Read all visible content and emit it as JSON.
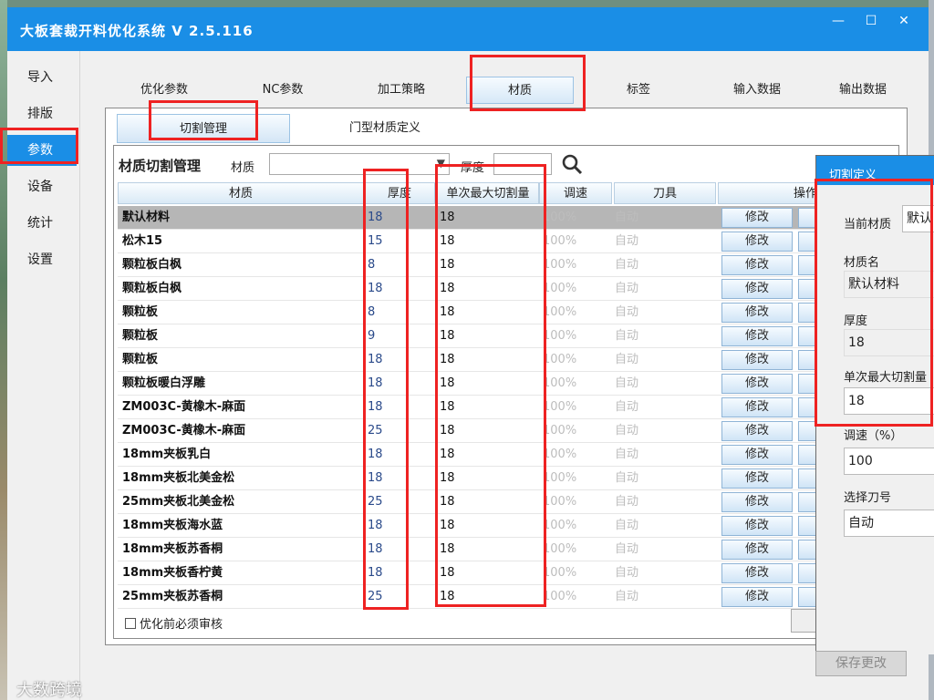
{
  "window": {
    "title": "大板套裁开料优化系统  V 2.5.116",
    "controls": {
      "minimize": "—",
      "maximize": "☐",
      "close": "✕"
    }
  },
  "leftnav": [
    "导入",
    "排版",
    "参数",
    "设备",
    "统计",
    "设置"
  ],
  "toptabs": [
    "优化参数",
    "NC参数",
    "加工策略",
    "材质",
    "标签",
    "输入数据",
    "输出数据"
  ],
  "subtabs": [
    "切割管理",
    "门型材质定义"
  ],
  "toolbar": {
    "title": "材质切割管理",
    "material_label": "材质",
    "material_value": "",
    "thickness_label": "厚度",
    "thickness_value": ""
  },
  "table": {
    "headers": [
      "材质",
      "厚度",
      "单次最大切割量",
      "调速",
      "刀具",
      "操作"
    ],
    "rows": [
      {
        "name": "默认材料",
        "thick": "18",
        "max": "18",
        "speed": "100%",
        "tool": "自动"
      },
      {
        "name": "松木15",
        "thick": "15",
        "max": "18",
        "speed": "100%",
        "tool": "自动"
      },
      {
        "name": "颗粒板白枫",
        "thick": "8",
        "max": "18",
        "speed": "100%",
        "tool": "自动"
      },
      {
        "name": "颗粒板白枫",
        "thick": "18",
        "max": "18",
        "speed": "100%",
        "tool": "自动"
      },
      {
        "name": "颗粒板",
        "thick": "8",
        "max": "18",
        "speed": "100%",
        "tool": "自动"
      },
      {
        "name": "颗粒板",
        "thick": "9",
        "max": "18",
        "speed": "100%",
        "tool": "自动"
      },
      {
        "name": "颗粒板",
        "thick": "18",
        "max": "18",
        "speed": "100%",
        "tool": "自动"
      },
      {
        "name": "颗粒板暖白浮雕",
        "thick": "18",
        "max": "18",
        "speed": "100%",
        "tool": "自动"
      },
      {
        "name": "ZM003C-黄橡木-麻面",
        "thick": "18",
        "max": "18",
        "speed": "100%",
        "tool": "自动"
      },
      {
        "name": "ZM003C-黄橡木-麻面",
        "thick": "25",
        "max": "18",
        "speed": "100%",
        "tool": "自动"
      },
      {
        "name": "18mm夹板乳白",
        "thick": "18",
        "max": "18",
        "speed": "100%",
        "tool": "自动"
      },
      {
        "name": "18mm夹板北美金松",
        "thick": "18",
        "max": "18",
        "speed": "100%",
        "tool": "自动"
      },
      {
        "name": "25mm夹板北美金松",
        "thick": "25",
        "max": "18",
        "speed": "100%",
        "tool": "自动"
      },
      {
        "name": "18mm夹板海水蓝",
        "thick": "18",
        "max": "18",
        "speed": "100%",
        "tool": "自动"
      },
      {
        "name": "18mm夹板苏香桐",
        "thick": "18",
        "max": "18",
        "speed": "100%",
        "tool": "自动"
      },
      {
        "name": "18mm夹板香柠黄",
        "thick": "18",
        "max": "18",
        "speed": "100%",
        "tool": "自动"
      },
      {
        "name": "25mm夹板苏香桐",
        "thick": "25",
        "max": "18",
        "speed": "100%",
        "tool": "自动"
      }
    ],
    "edit_label": "修改"
  },
  "footer": {
    "check_label": "优化前必须审核"
  },
  "dialog": {
    "title": "切割定义",
    "current_material_label": "当前材质",
    "current_material_value": "默认",
    "material_name_label": "材质名",
    "material_name_value": "默认材料",
    "thickness_label": "厚度",
    "thickness_value": "18",
    "max_cut_label": "单次最大切割量",
    "max_cut_value": "18",
    "speed_label": "调速（%）",
    "speed_value": "100",
    "tool_label": "选择刀号",
    "tool_value": "自动",
    "save_label": "保存更改"
  },
  "watermark": "大数跨境",
  "colors": {
    "accent": "#1a8ee6",
    "highlight": "#ee2222",
    "selected_row": "#b6b6b6"
  }
}
